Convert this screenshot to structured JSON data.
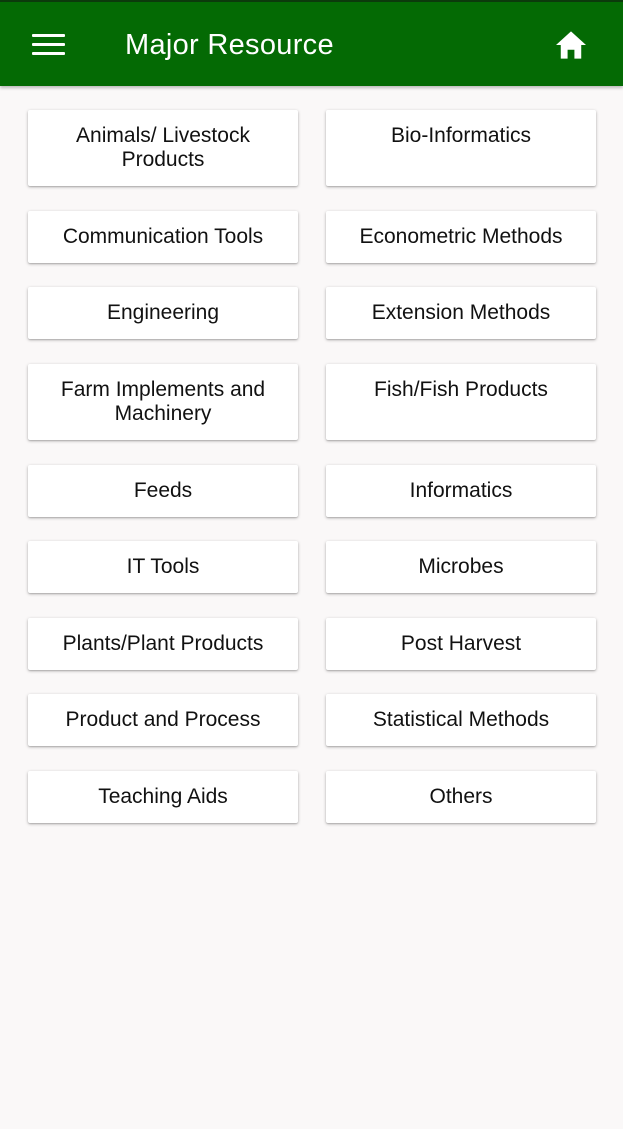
{
  "app_bar": {
    "title": "Major Resource",
    "background_color": "#046a04",
    "menu_icon": "hamburger-menu-icon",
    "home_icon": "home-icon"
  },
  "resources": [
    {
      "left": "Animals/ Livestock Products",
      "right": "Bio-Informatics"
    },
    {
      "left": "Communication Tools",
      "right": "Econometric Methods"
    },
    {
      "left": "Engineering",
      "right": "Extension Methods"
    },
    {
      "left": "Farm Implements and Machinery",
      "right": "Fish/Fish Products"
    },
    {
      "left": "Feeds",
      "right": "Informatics"
    },
    {
      "left": "IT Tools",
      "right": "Microbes"
    },
    {
      "left": "Plants/Plant Products",
      "right": "Post Harvest"
    },
    {
      "left": "Product and Process",
      "right": "Statistical Methods"
    },
    {
      "left": "Teaching Aids",
      "right": "Others"
    }
  ]
}
